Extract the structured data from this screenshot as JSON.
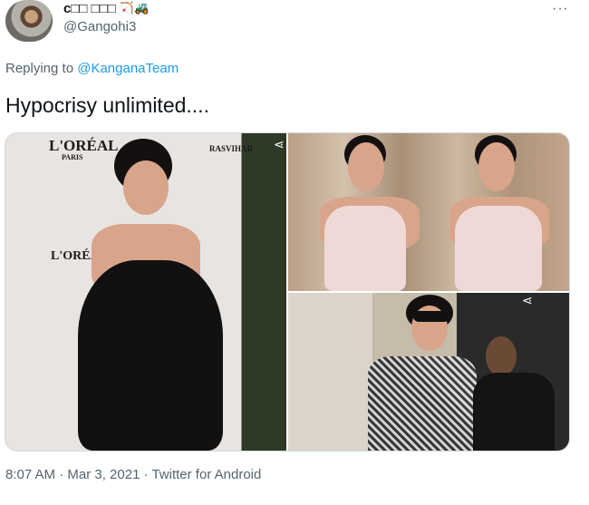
{
  "author": {
    "display_name": "c□□ □□□",
    "emojis": "🏹🚜",
    "handle": "@Gangohi3"
  },
  "more_icon": "more-dots-icon",
  "reply": {
    "prefix": "Replying to ",
    "target": "@KanganaTeam"
  },
  "tweet_text": "Hypocrisy unlimited....",
  "media": {
    "left_photo_brand_1": "L'ORÉAL",
    "left_photo_brand_2": "L'ORÉAL",
    "left_photo_brand_3": "RASVIHAR",
    "left_photo_sub": "PARIS"
  },
  "meta": "8:07 AM · Mar 3, 2021 · Twitter for Android",
  "colors": {
    "link": "#1d9bf0",
    "muted": "#536471",
    "text": "#0f1419"
  }
}
